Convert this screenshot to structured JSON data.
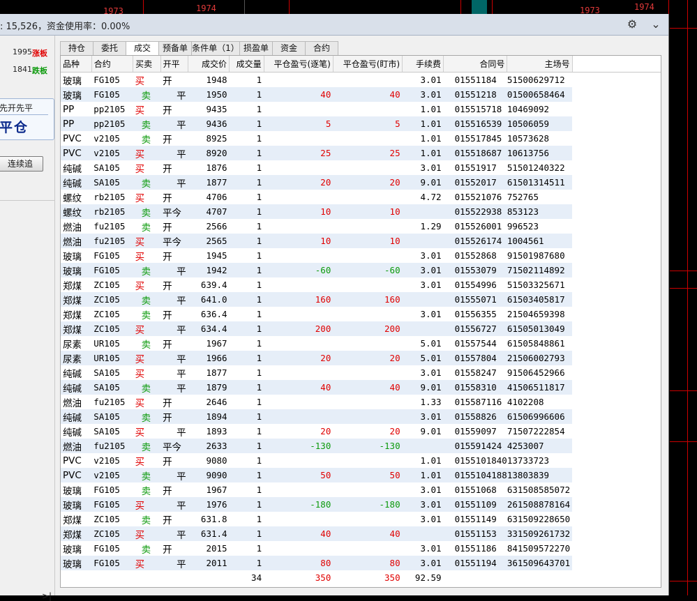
{
  "chart": {
    "labels": [
      "1973",
      "1974",
      "1973",
      "1974"
    ],
    "line_color": "#cc0000"
  },
  "titlebar": {
    "account_text": ": 15,526，资金使用率：0.00%",
    "settings_icon": "gear-icon",
    "collapse_icon": "chevron-down-icon"
  },
  "left_panel": {
    "limit_up_value": "1995",
    "limit_up_label": "涨板",
    "limit_down_value": "1841",
    "limit_down_label": "跌板",
    "mode_text": "先开先平",
    "close_label": "平仓",
    "chase_button": "连续追",
    "collapse_icon": "expand-right-icon",
    "collapse_text": ">|"
  },
  "tabs": [
    {
      "label": "持仓",
      "active": false
    },
    {
      "label": "委托",
      "active": false
    },
    {
      "label": "成交",
      "active": true
    },
    {
      "label": "预备单",
      "active": false
    },
    {
      "label": "条件单（1）",
      "active": false
    },
    {
      "label": "损盈单",
      "active": false
    },
    {
      "label": "资金",
      "active": false
    },
    {
      "label": "合约",
      "active": false
    }
  ],
  "columns": [
    "品种",
    "合约",
    "买卖",
    "开平",
    "成交价",
    "成交量",
    "平仓盈亏(逐笔)",
    "平仓盈亏(盯市)",
    "手续费",
    "合同号",
    "主场号"
  ],
  "rows": [
    {
      "name": "玻璃",
      "code": "FG105",
      "side": "买",
      "oc": "开",
      "price": "1948",
      "vol": "1",
      "pnl1": "",
      "pnl2": "",
      "fee": "3.01",
      "contract": "01551184",
      "main": "51500629712"
    },
    {
      "name": "玻璃",
      "code": "FG105",
      "side": "卖",
      "oc": "平",
      "price": "1950",
      "vol": "1",
      "pnl1": "40",
      "pnl2": "40",
      "fee": "3.01",
      "contract": "01551218",
      "main": "01500658464"
    },
    {
      "name": "PP",
      "code": "pp2105",
      "side": "买",
      "oc": "开",
      "price": "9435",
      "vol": "1",
      "pnl1": "",
      "pnl2": "",
      "fee": "1.01",
      "contract": "015515718",
      "main": "10469092"
    },
    {
      "name": "PP",
      "code": "pp2105",
      "side": "卖",
      "oc": "平",
      "price": "9436",
      "vol": "1",
      "pnl1": "5",
      "pnl2": "5",
      "fee": "1.01",
      "contract": "015516539",
      "main": "10506059"
    },
    {
      "name": "PVC",
      "code": "v2105",
      "side": "卖",
      "oc": "开",
      "price": "8925",
      "vol": "1",
      "pnl1": "",
      "pnl2": "",
      "fee": "1.01",
      "contract": "015517845",
      "main": "10573628"
    },
    {
      "name": "PVC",
      "code": "v2105",
      "side": "买",
      "oc": "平",
      "price": "8920",
      "vol": "1",
      "pnl1": "25",
      "pnl2": "25",
      "fee": "1.01",
      "contract": "015518687",
      "main": "10613756"
    },
    {
      "name": "纯碱",
      "code": "SA105",
      "side": "买",
      "oc": "开",
      "price": "1876",
      "vol": "1",
      "pnl1": "",
      "pnl2": "",
      "fee": "3.01",
      "contract": "01551917",
      "main": "51501240322"
    },
    {
      "name": "纯碱",
      "code": "SA105",
      "side": "卖",
      "oc": "平",
      "price": "1877",
      "vol": "1",
      "pnl1": "20",
      "pnl2": "20",
      "fee": "9.01",
      "contract": "01552017",
      "main": "61501314511"
    },
    {
      "name": "螺纹",
      "code": "rb2105",
      "side": "买",
      "oc": "开",
      "price": "4706",
      "vol": "1",
      "pnl1": "",
      "pnl2": "",
      "fee": "4.72",
      "contract": "015521076",
      "main": "752765"
    },
    {
      "name": "螺纹",
      "code": "rb2105",
      "side": "卖",
      "oc": "平今",
      "price": "4707",
      "vol": "1",
      "pnl1": "10",
      "pnl2": "10",
      "fee": "",
      "contract": "015522938",
      "main": "853123"
    },
    {
      "name": "燃油",
      "code": "fu2105",
      "side": "卖",
      "oc": "开",
      "price": "2566",
      "vol": "1",
      "pnl1": "",
      "pnl2": "",
      "fee": "1.29",
      "contract": "015526001",
      "main": "996523"
    },
    {
      "name": "燃油",
      "code": "fu2105",
      "side": "买",
      "oc": "平今",
      "price": "2565",
      "vol": "1",
      "pnl1": "10",
      "pnl2": "10",
      "fee": "",
      "contract": "015526174",
      "main": "1004561"
    },
    {
      "name": "玻璃",
      "code": "FG105",
      "side": "买",
      "oc": "开",
      "price": "1945",
      "vol": "1",
      "pnl1": "",
      "pnl2": "",
      "fee": "3.01",
      "contract": "01552868",
      "main": "91501987680"
    },
    {
      "name": "玻璃",
      "code": "FG105",
      "side": "卖",
      "oc": "平",
      "price": "1942",
      "vol": "1",
      "pnl1": "-60",
      "pnl2": "-60",
      "fee": "3.01",
      "contract": "01553079",
      "main": "71502114892"
    },
    {
      "name": "郑煤",
      "code": "ZC105",
      "side": "买",
      "oc": "开",
      "price": "639.4",
      "vol": "1",
      "pnl1": "",
      "pnl2": "",
      "fee": "3.01",
      "contract": "01554996",
      "main": "51503325671"
    },
    {
      "name": "郑煤",
      "code": "ZC105",
      "side": "卖",
      "oc": "平",
      "price": "641.0",
      "vol": "1",
      "pnl1": "160",
      "pnl2": "160",
      "fee": "",
      "contract": "01555071",
      "main": "61503405817"
    },
    {
      "name": "郑煤",
      "code": "ZC105",
      "side": "卖",
      "oc": "开",
      "price": "636.4",
      "vol": "1",
      "pnl1": "",
      "pnl2": "",
      "fee": "3.01",
      "contract": "01556355",
      "main": "21504659398"
    },
    {
      "name": "郑煤",
      "code": "ZC105",
      "side": "买",
      "oc": "平",
      "price": "634.4",
      "vol": "1",
      "pnl1": "200",
      "pnl2": "200",
      "fee": "",
      "contract": "01556727",
      "main": "61505013049"
    },
    {
      "name": "尿素",
      "code": "UR105",
      "side": "卖",
      "oc": "开",
      "price": "1967",
      "vol": "1",
      "pnl1": "",
      "pnl2": "",
      "fee": "5.01",
      "contract": "01557544",
      "main": "61505848861"
    },
    {
      "name": "尿素",
      "code": "UR105",
      "side": "买",
      "oc": "平",
      "price": "1966",
      "vol": "1",
      "pnl1": "20",
      "pnl2": "20",
      "fee": "5.01",
      "contract": "01557804",
      "main": "21506002793"
    },
    {
      "name": "纯碱",
      "code": "SA105",
      "side": "买",
      "oc": "平",
      "price": "1877",
      "vol": "1",
      "pnl1": "",
      "pnl2": "",
      "fee": "3.01",
      "contract": "01558247",
      "main": "91506452966"
    },
    {
      "name": "纯碱",
      "code": "SA105",
      "side": "卖",
      "oc": "平",
      "price": "1879",
      "vol": "1",
      "pnl1": "40",
      "pnl2": "40",
      "fee": "9.01",
      "contract": "01558310",
      "main": "41506511817"
    },
    {
      "name": "燃油",
      "code": "fu2105",
      "side": "买",
      "oc": "开",
      "price": "2646",
      "vol": "1",
      "pnl1": "",
      "pnl2": "",
      "fee": "1.33",
      "contract": "015587116",
      "main": "4102208"
    },
    {
      "name": "纯碱",
      "code": "SA105",
      "side": "卖",
      "oc": "开",
      "price": "1894",
      "vol": "1",
      "pnl1": "",
      "pnl2": "",
      "fee": "3.01",
      "contract": "01558826",
      "main": "61506996606"
    },
    {
      "name": "纯碱",
      "code": "SA105",
      "side": "买",
      "oc": "平",
      "price": "1893",
      "vol": "1",
      "pnl1": "20",
      "pnl2": "20",
      "fee": "9.01",
      "contract": "01559097",
      "main": "71507222854"
    },
    {
      "name": "燃油",
      "code": "fu2105",
      "side": "卖",
      "oc": "平今",
      "price": "2633",
      "vol": "1",
      "pnl1": "-130",
      "pnl2": "-130",
      "fee": "",
      "contract": "015591424",
      "main": "4253007"
    },
    {
      "name": "PVC",
      "code": "v2105",
      "side": "买",
      "oc": "开",
      "price": "9080",
      "vol": "1",
      "pnl1": "",
      "pnl2": "",
      "fee": "1.01",
      "contract": "0155101840",
      "main": "13733723"
    },
    {
      "name": "PVC",
      "code": "v2105",
      "side": "卖",
      "oc": "平",
      "price": "9090",
      "vol": "1",
      "pnl1": "50",
      "pnl2": "50",
      "fee": "1.01",
      "contract": "0155104188",
      "main": "13803839"
    },
    {
      "name": "玻璃",
      "code": "FG105",
      "side": "卖",
      "oc": "开",
      "price": "1967",
      "vol": "1",
      "pnl1": "",
      "pnl2": "",
      "fee": "3.01",
      "contract": "01551068",
      "main": "631508585072"
    },
    {
      "name": "玻璃",
      "code": "FG105",
      "side": "买",
      "oc": "平",
      "price": "1976",
      "vol": "1",
      "pnl1": "-180",
      "pnl2": "-180",
      "fee": "3.01",
      "contract": "01551109",
      "main": "261508878164"
    },
    {
      "name": "郑煤",
      "code": "ZC105",
      "side": "卖",
      "oc": "开",
      "price": "631.8",
      "vol": "1",
      "pnl1": "",
      "pnl2": "",
      "fee": "3.01",
      "contract": "01551149",
      "main": "631509228650"
    },
    {
      "name": "郑煤",
      "code": "ZC105",
      "side": "买",
      "oc": "平",
      "price": "631.4",
      "vol": "1",
      "pnl1": "40",
      "pnl2": "40",
      "fee": "",
      "contract": "01551153",
      "main": "331509261732"
    },
    {
      "name": "玻璃",
      "code": "FG105",
      "side": "卖",
      "oc": "开",
      "price": "2015",
      "vol": "1",
      "pnl1": "",
      "pnl2": "",
      "fee": "3.01",
      "contract": "01551186",
      "main": "841509572270"
    },
    {
      "name": "玻璃",
      "code": "FG105",
      "side": "买",
      "oc": "平",
      "price": "2011",
      "vol": "1",
      "pnl1": "80",
      "pnl2": "80",
      "fee": "3.01",
      "contract": "01551194",
      "main": "361509643701"
    }
  ],
  "summary": {
    "vol": "34",
    "pnl1": "350",
    "pnl2": "350",
    "fee": "92.59"
  },
  "colors": {
    "buy": "#e00000",
    "sell": "#0c9a0c",
    "row_alt": "#e6eef8",
    "accent": "#0b2a8c"
  }
}
